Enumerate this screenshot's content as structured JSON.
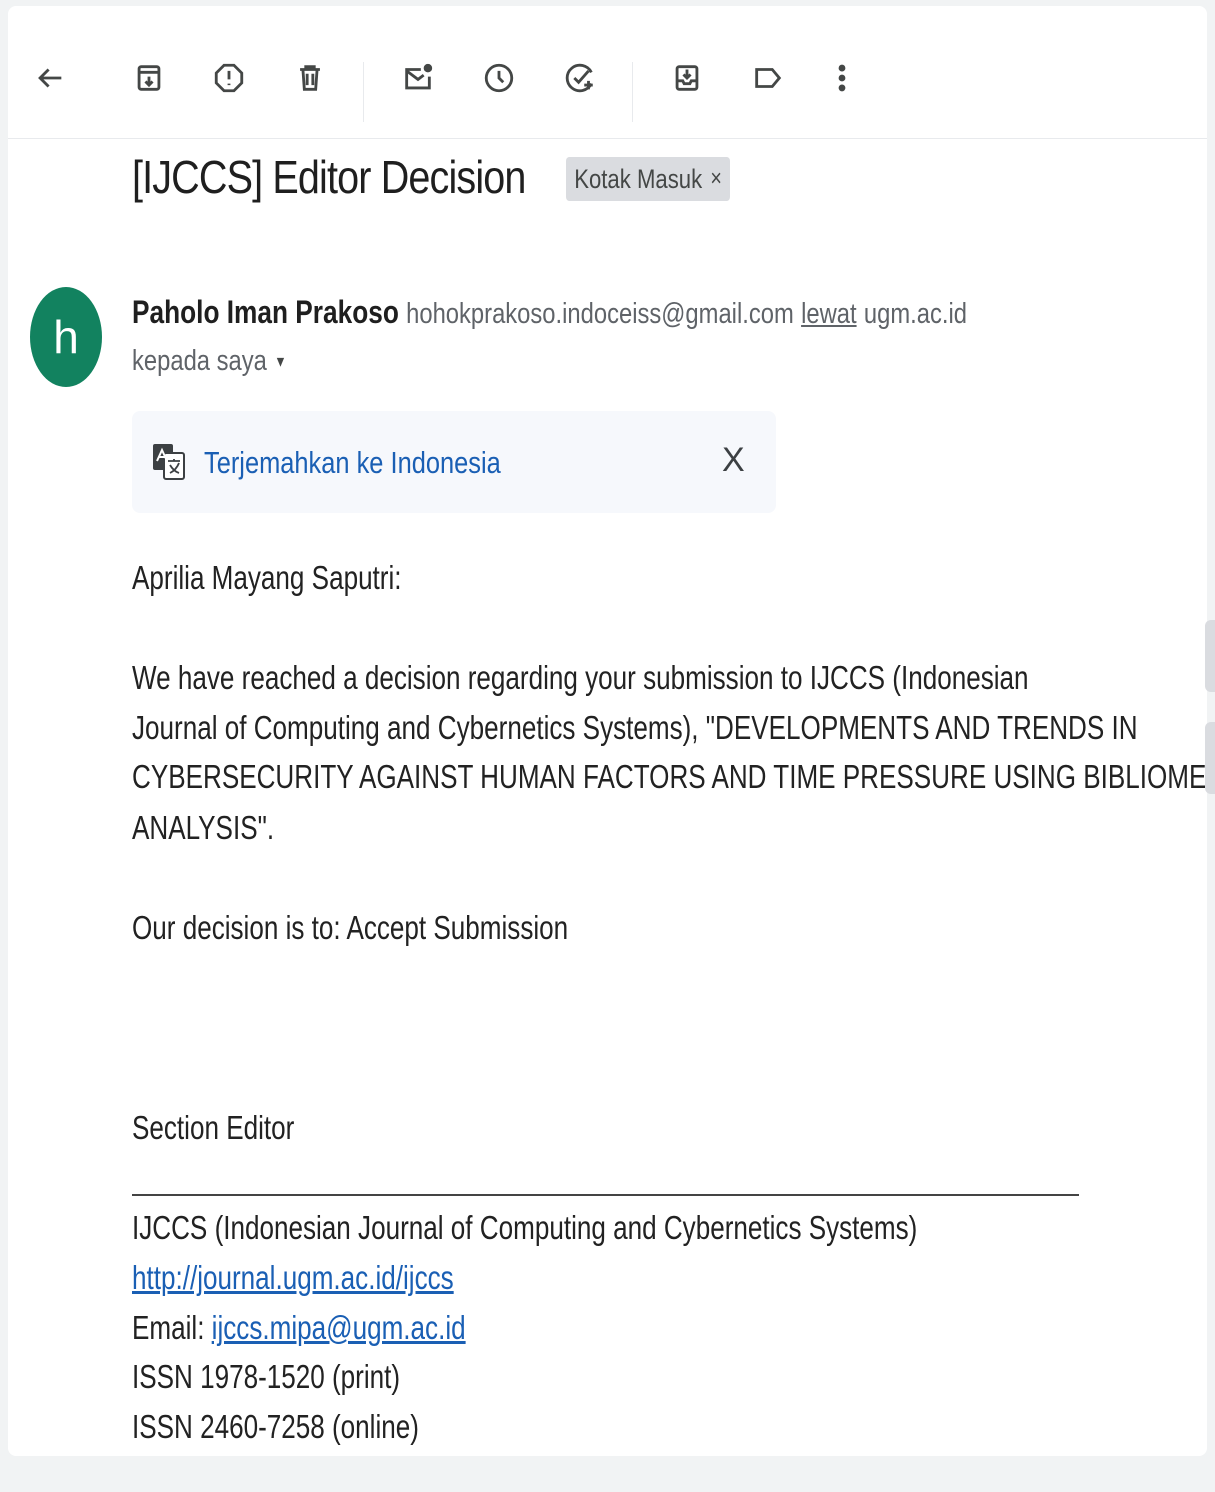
{
  "toolbar": {
    "back": "back-arrow-icon",
    "buttons": [
      "archive-icon",
      "report-spam-icon",
      "delete-icon",
      "mark-unread-icon",
      "snooze-icon",
      "add-task-icon",
      "move-to-icon",
      "label-icon",
      "more-vert-icon"
    ]
  },
  "subject": "[IJCCS] Editor Decision",
  "label_chip": {
    "text": "Kotak Masuk",
    "close": "×"
  },
  "sender": {
    "avatar_letter": "h",
    "name": "Paholo Iman Prakoso",
    "email": "hohokprakoso.indoceiss@gmail.com",
    "via_label": "lewat",
    "via_domain": "ugm.ac.id",
    "recipient": "kepada saya",
    "caret": "▾"
  },
  "translate": {
    "link": "Terjemahkan ke Indonesia",
    "close": "X"
  },
  "body": {
    "greeting": "Aprilia Mayang Saputri:",
    "p1_line1": "We have reached a decision regarding your submission to IJCCS (Indonesian",
    "p1_line2": "Journal of Computing and Cybernetics Systems), \"DEVELOPMENTS AND TRENDS IN",
    "p1_line3": "CYBERSECURITY AGAINST HUMAN FACTORS AND TIME PRESSURE USING BIBLIOMETRIC",
    "p1_line4": "ANALYSIS\".",
    "decision": "Our decision is to: Accept Submission",
    "signature_role": "Section Editor"
  },
  "footer": {
    "journal": "IJCCS (Indonesian Journal of Computing and Cybernetics Systems)",
    "url": "http://journal.ugm.ac.id/ijccs",
    "email_label": "Email: ",
    "email": "ijccs.mipa@ugm.ac.id",
    "issn_print": "ISSN 1978-1520 (print)",
    "issn_online": "ISSN 2460-7258 (online)"
  }
}
